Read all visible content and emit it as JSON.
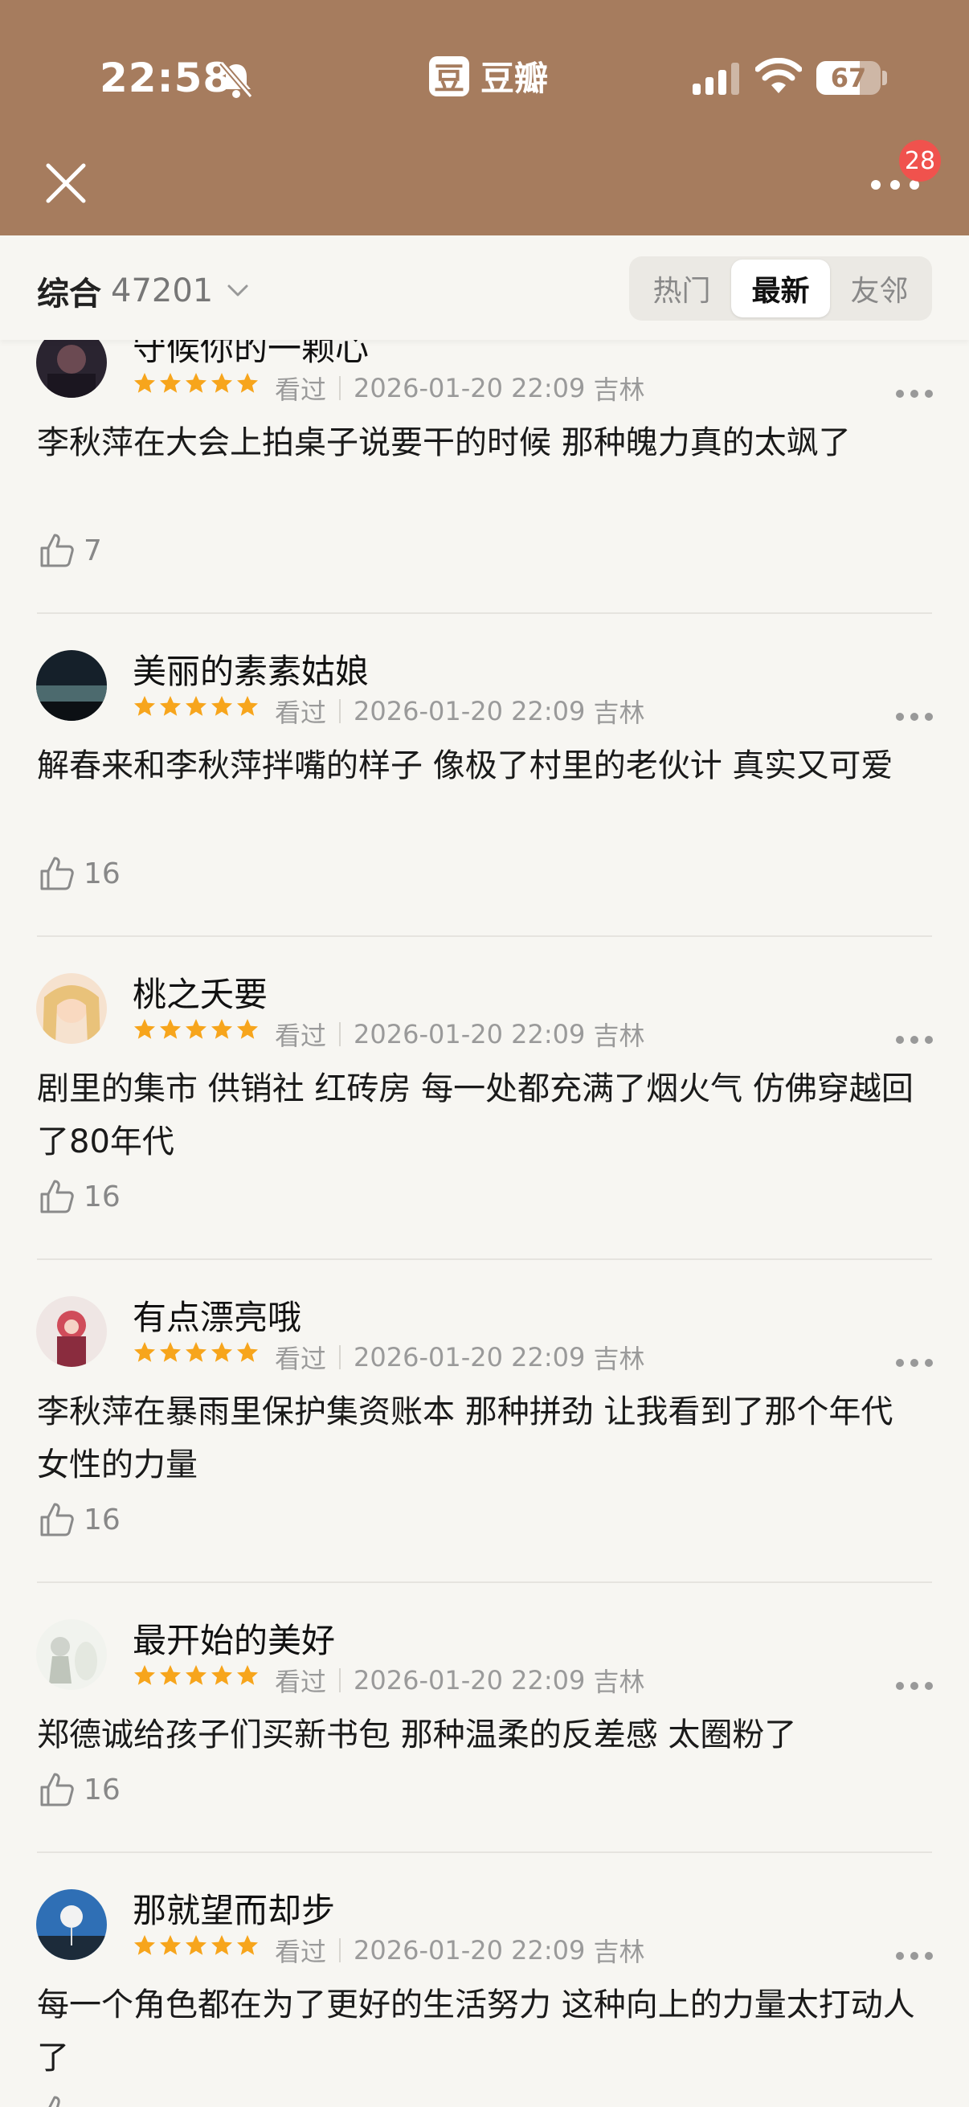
{
  "status_bar": {
    "time": "22:58",
    "battery": "67",
    "battery_level": 0.67
  },
  "app": {
    "name": "豆瓣",
    "logo_glyph": "豆"
  },
  "header": {
    "notification_count": "28"
  },
  "filter": {
    "sort_label": "综合",
    "count": "47201",
    "tabs": [
      {
        "label": "热门",
        "active": false
      },
      {
        "label": "最新",
        "active": true
      },
      {
        "label": "友邻",
        "active": false
      }
    ]
  },
  "colors": {
    "header_bg": "#a67c5e",
    "star": "#f7a51c",
    "badge": "#f0524d"
  },
  "comments": [
    {
      "username": "守候你的一颗心",
      "rating": 5,
      "status": "看过",
      "time": "2026-01-20 22:09",
      "location": "吉林",
      "text": "李秋萍在大会上拍桌子说要干的时候 那种魄力真的太飒了",
      "likes": "7"
    },
    {
      "username": "美丽的素素姑娘",
      "rating": 5,
      "status": "看过",
      "time": "2026-01-20 22:09",
      "location": "吉林",
      "text": "解春来和李秋萍拌嘴的样子 像极了村里的老伙计 真实又可爱",
      "likes": "16"
    },
    {
      "username": "桃之夭要",
      "rating": 5,
      "status": "看过",
      "time": "2026-01-20 22:09",
      "location": "吉林",
      "text": "剧里的集市 供销社 红砖房 每一处都充满了烟火气 仿佛穿越回了80年代",
      "likes": "16"
    },
    {
      "username": "有点漂亮哦",
      "rating": 5,
      "status": "看过",
      "time": "2026-01-20 22:09",
      "location": "吉林",
      "text": "李秋萍在暴雨里保护集资账本 那种拼劲 让我看到了那个年代女性的力量",
      "likes": "16"
    },
    {
      "username": "最开始的美好",
      "rating": 5,
      "status": "看过",
      "time": "2026-01-20 22:09",
      "location": "吉林",
      "text": "郑德诚给孩子们买新书包 那种温柔的反差感 太圈粉了",
      "likes": "16"
    },
    {
      "username": "那就望而却步",
      "rating": 5,
      "status": "看过",
      "time": "2026-01-20 22:09",
      "location": "吉林",
      "text": "每一个角色都在为了更好的生活努力 这种向上的力量太打动人了",
      "likes": ""
    }
  ]
}
